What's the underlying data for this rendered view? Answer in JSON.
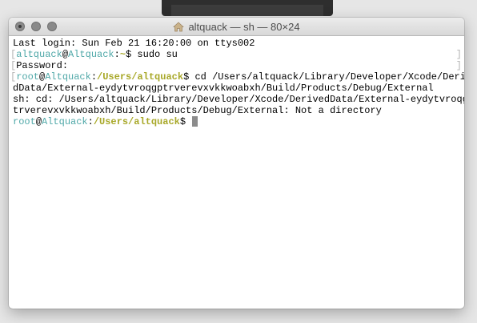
{
  "window": {
    "title": "altquack — sh — 80×24"
  },
  "terminal": {
    "last_login": "Last login: Sun Feb 21 16:20:00 on ttys002",
    "line2": {
      "user": "altquack",
      "at": "@",
      "host": "Altquack",
      "sep": ":",
      "path": "~",
      "prompt": "$",
      "command": " sudo su"
    },
    "password_prompt": "Password:",
    "line4": {
      "user": "root",
      "at": "@",
      "host": "Altquack",
      "sep": ":",
      "path": "/Users/altquack",
      "prompt": "$",
      "command": " cd /Users/altquack/Library/Developer/Xcode/Derive"
    },
    "line5": "dData/External-eydytvroqgptrverevxvkkwoabxh/Build/Products/Debug/External",
    "error_line1": "sh: cd: /Users/altquack/Library/Developer/Xcode/DerivedData/External-eydytvroqgp",
    "error_line2": "trverevxvkkwoabxh/Build/Products/Debug/External: Not a directory",
    "line8": {
      "user": "root",
      "at": "@",
      "host": "Altquack",
      "sep": ":",
      "path": "/Users/altquack",
      "prompt": "$",
      "command": " "
    },
    "brackets": {
      "left": "[",
      "right": "]"
    }
  },
  "colors": {
    "user_cyan": "#4fa8a8",
    "path_yellow": "#a8a828",
    "background": "#ffffff",
    "cursor": "#8c8c8c"
  },
  "icons": {
    "title_icon": "house-icon",
    "close_button": "close-icon",
    "minimize_button": "minimize-icon",
    "maximize_button": "maximize-icon"
  }
}
